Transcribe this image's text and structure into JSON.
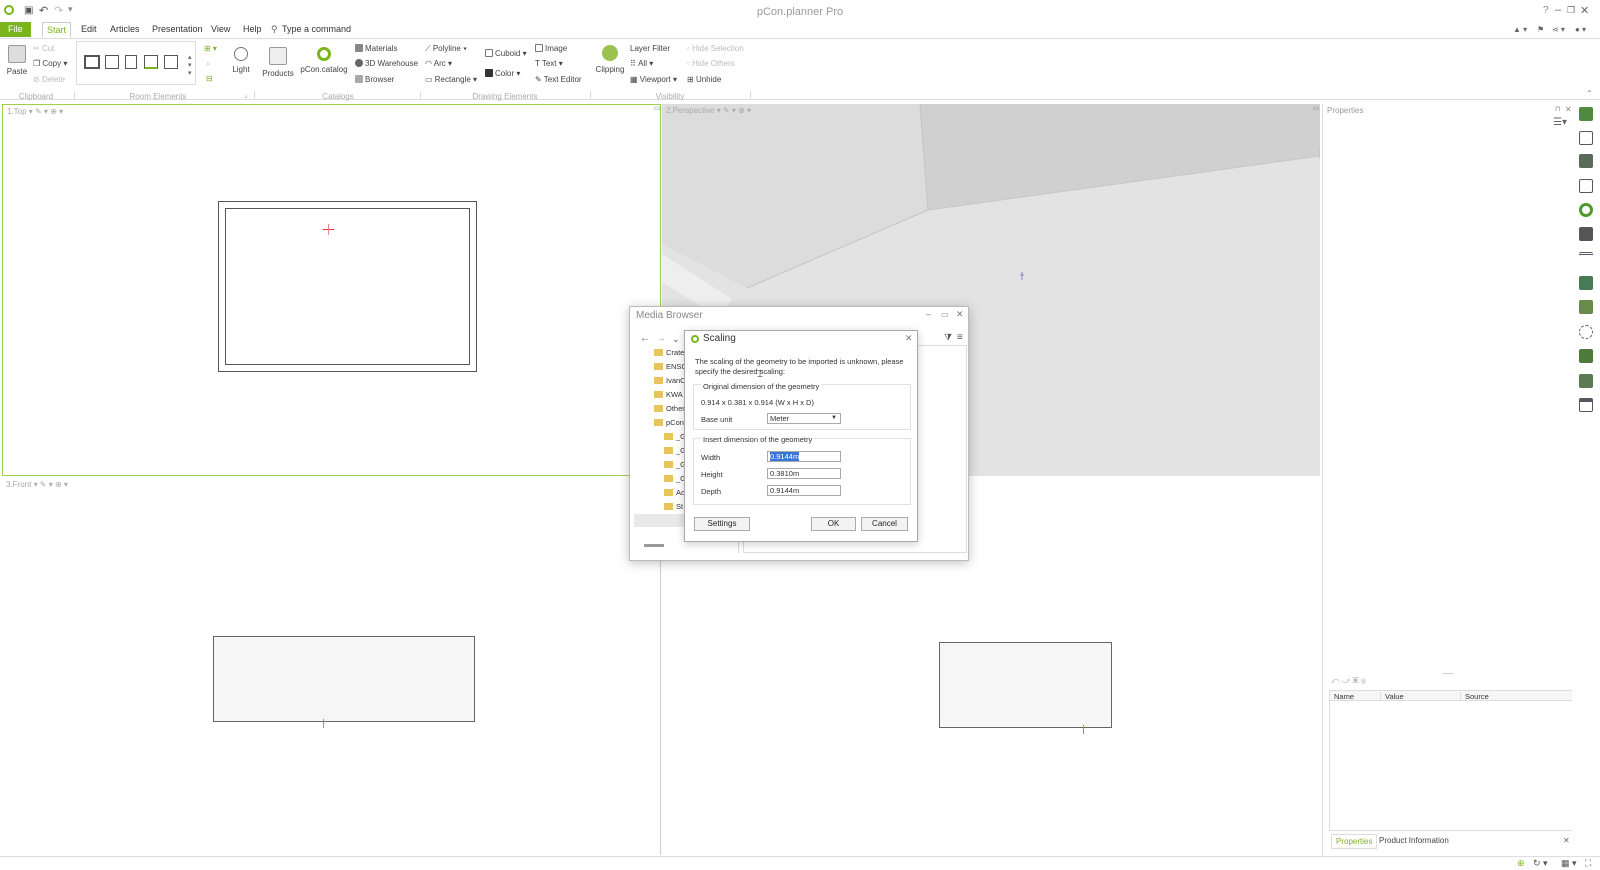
{
  "app": {
    "title": "pCon.planner Pro",
    "command_placeholder": "Type a command"
  },
  "menu": [
    "File",
    "Start",
    "Edit",
    "Articles",
    "Presentation",
    "View",
    "Help"
  ],
  "ribbon": {
    "clipboard": {
      "paste": "Paste",
      "cut": "Cut",
      "copy": "Copy",
      "delete": "Delete",
      "group": "Clipboard"
    },
    "room_group": "Room Elements",
    "light": "Light",
    "products": "Products",
    "catalog": "pCon.catalog",
    "catalogs": {
      "materials": "Materials",
      "warehouse": "3D Warehouse",
      "browser": "Browser",
      "group": "Catalogs"
    },
    "drawing": {
      "polyline": "Polyline",
      "arc": "Arc",
      "rectangle": "Rectangle",
      "cuboid": "Cuboid",
      "color": "Color",
      "image": "Image",
      "text": "Text",
      "text_editor": "Text Editor",
      "group": "Drawing Elements"
    },
    "clipping": "Clipping",
    "visibility": {
      "layer_filter": "Layer Filter",
      "all": "All",
      "viewport": "Viewport",
      "hide_selection": "Hide Selection",
      "hide_others": "Hide Others",
      "unhide": "Unhide",
      "group": "Visibility"
    }
  },
  "viewports": {
    "top": "1.Top",
    "perspective": "2.Perspective",
    "front": "3.Front"
  },
  "media_browser": {
    "title": "Media Browser",
    "folders": [
      "Crate",
      "ENSC",
      "IvanC",
      "KWA",
      "Other",
      "pCon",
      "_G",
      "_G",
      "_G",
      "_G",
      "Ac",
      "St"
    ]
  },
  "scaling": {
    "title": "Scaling",
    "message": "The scaling of the geometry to be imported is unknown, please specify the desired scaling:",
    "original_header": "Original dimension of the geometry",
    "original_dims": "0.914 x 0.381 x 0.914 (W x H x D)",
    "base_unit_label": "Base unit",
    "base_unit_value": "Meter",
    "insert_header": "Insert dimension of the geometry",
    "width_label": "Width",
    "width_value": "0.9144m",
    "height_label": "Height",
    "height_value": "0.3810m",
    "depth_label": "Depth",
    "depth_value": "0.9144m",
    "settings": "Settings",
    "ok": "OK",
    "cancel": "Cancel"
  },
  "properties": {
    "title": "Properties",
    "columns": [
      "Name",
      "Value",
      "Source"
    ],
    "tabs": [
      "Properties",
      "Product Information"
    ]
  },
  "colors": {
    "accent": "#7ab51d"
  }
}
